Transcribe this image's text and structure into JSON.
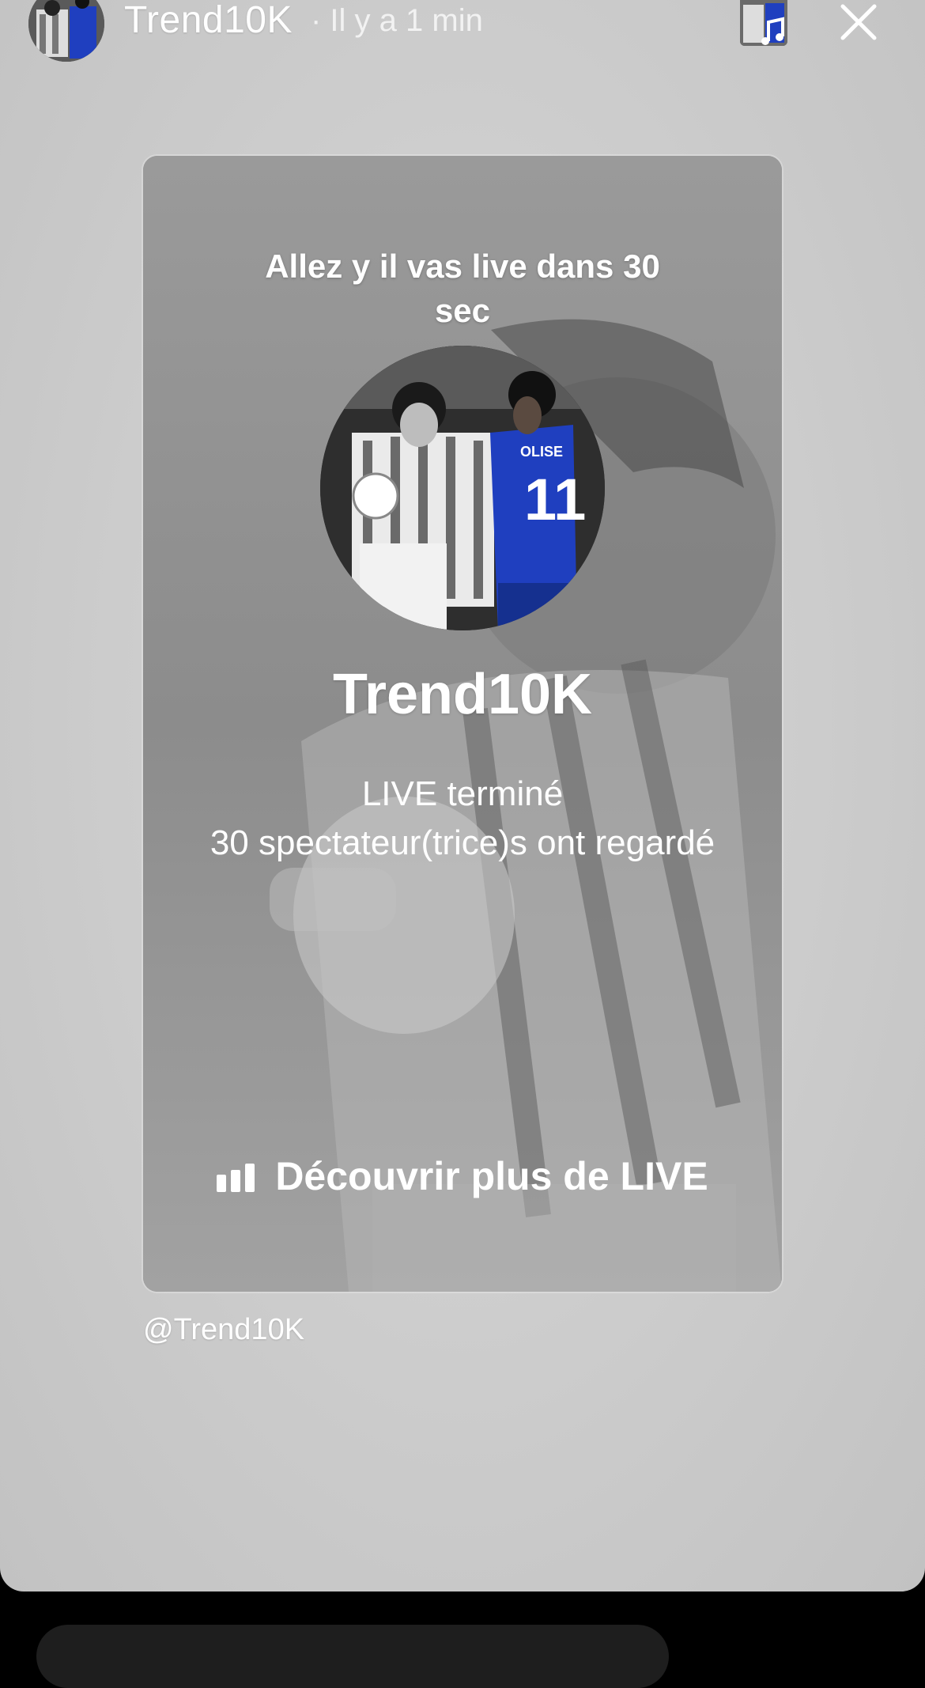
{
  "header": {
    "username": "Trend10K",
    "time": "· Il y a 1 min"
  },
  "icons": {
    "avatar": "avatar",
    "music": "music-note-icon",
    "close": "close-icon",
    "bars": "bar-chart-icon"
  },
  "card": {
    "caption": "Allez y il vas live dans 30 sec",
    "name": "Trend10K",
    "status_line1": "LIVE terminé",
    "status_line2": "30 spectateur(trice)s ont regardé",
    "discover_label": "Découvrir plus de LIVE"
  },
  "footer": {
    "handle": "@Trend10K"
  },
  "jersey_text": {
    "name": "OLISE",
    "number": "11"
  },
  "colors": {
    "background": "#cfcfcf",
    "text": "#ffffff",
    "blue_jersey": "#1f3fbf"
  }
}
